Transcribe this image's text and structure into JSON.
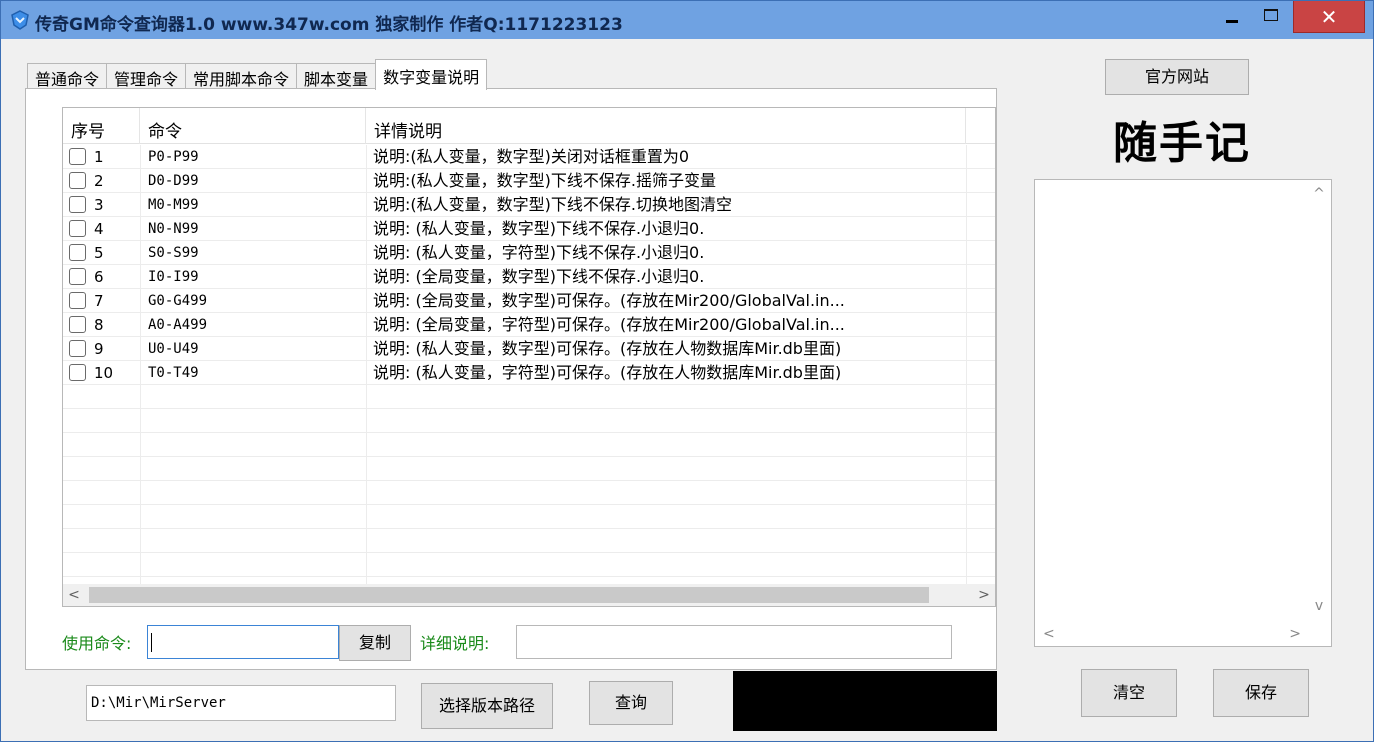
{
  "window": {
    "title": "传奇GM命令查询器1.0 www.347w.com 独家制作 作者Q:1171223123",
    "close_glyph": "✕"
  },
  "tabs": [
    {
      "label": "普通命令",
      "active": false
    },
    {
      "label": "管理命令",
      "active": false
    },
    {
      "label": "常用脚本命令",
      "active": false
    },
    {
      "label": "脚本变量",
      "active": false
    },
    {
      "label": "数字变量说明",
      "active": true
    }
  ],
  "table": {
    "columns": [
      "序号",
      "命令",
      "详情说明"
    ],
    "rows": [
      {
        "no": "1",
        "cmd": "P0-P99",
        "desc": "说明:(私人变量，数字型)关闭对话框重置为0"
      },
      {
        "no": "2",
        "cmd": "D0-D99",
        "desc": "说明:(私人变量，数字型)下线不保存.摇筛子变量"
      },
      {
        "no": "3",
        "cmd": "M0-M99",
        "desc": "说明:(私人变量，数字型)下线不保存.切换地图清空"
      },
      {
        "no": "4",
        "cmd": "N0-N99",
        "desc": "说明: (私人变量，数字型)下线不保存.小退归0."
      },
      {
        "no": "5",
        "cmd": "S0-S99",
        "desc": "说明: (私人变量，字符型)下线不保存.小退归0."
      },
      {
        "no": "6",
        "cmd": "I0-I99",
        "desc": "说明: (全局变量，数字型)下线不保存.小退归0."
      },
      {
        "no": "7",
        "cmd": "G0-G499",
        "desc": "说明: (全局变量，数字型)可保存。(存放在Mir200/GlobalVal.in..."
      },
      {
        "no": "8",
        "cmd": "A0-A499",
        "desc": "说明: (全局变量，字符型)可保存。(存放在Mir200/GlobalVal.in..."
      },
      {
        "no": "9",
        "cmd": "U0-U49",
        "desc": "说明: (私人变量，数字型)可保存。(存放在人物数据库Mir.db里面)"
      },
      {
        "no": "10",
        "cmd": "T0-T49",
        "desc": "说明: (私人变量，字符型)可保存。(存放在人物数据库Mir.db里面)"
      }
    ]
  },
  "command_bar": {
    "use_label": "使用命令:",
    "use_value": "",
    "copy_label": "复制",
    "detail_label": "详细说明:",
    "detail_value": ""
  },
  "bottom": {
    "path_value": "D:\\Mir\\MirServer",
    "choose_label": "选择版本路径",
    "query_label": "查询"
  },
  "side": {
    "site_label": "官方网站",
    "note_title": "随手记",
    "notes_value": "",
    "clear_label": "清空",
    "save_label": "保存"
  }
}
